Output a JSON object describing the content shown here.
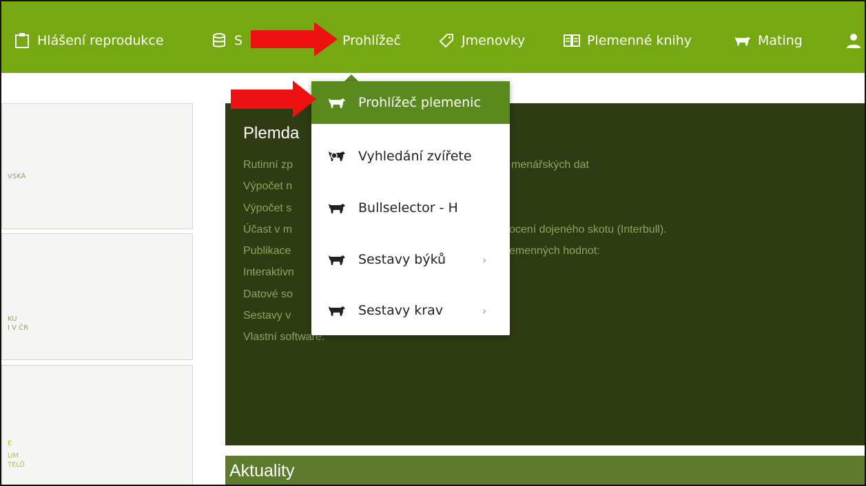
{
  "topnav": {
    "items": [
      {
        "label": "Hlášení reprodukce",
        "icon": "clipboard-icon"
      },
      {
        "label": "S",
        "icon": "database-icon"
      },
      {
        "label": "Prohlížeč",
        "icon": "arrow-pointer"
      },
      {
        "label": "Jmenovky",
        "icon": "tag-icon"
      },
      {
        "label": "Plemenné knihy",
        "icon": "book-icon"
      },
      {
        "label": "Mating",
        "icon": "cow-icon"
      },
      {
        "label": "",
        "icon": "user-icon"
      }
    ],
    "color": "#76a812"
  },
  "sidebar": {
    "tiles": [
      {
        "label_lines": [
          "VSKÁ"
        ]
      },
      {
        "label_lines": [
          "KU",
          "I V ČR"
        ]
      },
      {
        "label_lines": [
          "E",
          "UM",
          "TELŮ"
        ]
      }
    ]
  },
  "hero": {
    "title": "Plemda",
    "lines": [
      {
        "left": "Rutinní zp",
        "right": "menářských dat"
      },
      {
        "left": "Výpočet n",
        "right": ""
      },
      {
        "left": "Výpočet s",
        "right": ""
      },
      {
        "left": "Účast v m",
        "right": "ocení dojeného skotu (Interbull)."
      },
      {
        "left": "Publikace",
        "right": "emenných hodnot:"
      },
      {
        "left": "Interaktivn",
        "right": ""
      },
      {
        "left": "Datové so",
        "right": ""
      },
      {
        "left": "Sestavy v",
        "right": ""
      },
      {
        "left": "Vlastní software.",
        "right": ""
      }
    ]
  },
  "news": {
    "title": "Aktuality"
  },
  "dropdown": {
    "items": [
      {
        "label": "Prohlížeč plemenic",
        "icon": "cow-icon",
        "active": true,
        "submenu": false
      },
      {
        "label": "Vyhledání zvířete",
        "icon": "cow-search-icon",
        "active": false,
        "submenu": false
      },
      {
        "label": "Bullselector - H",
        "icon": "bull-icon",
        "active": false,
        "submenu": false
      },
      {
        "label": "Sestavy býků",
        "icon": "bull-icon",
        "active": false,
        "submenu": true
      },
      {
        "label": "Sestavy krav",
        "icon": "cow-icon",
        "active": false,
        "submenu": true
      }
    ],
    "chevron": "›",
    "accent": "#5a8a1e"
  },
  "annotations": {
    "arrow_color": "#ee1111"
  }
}
